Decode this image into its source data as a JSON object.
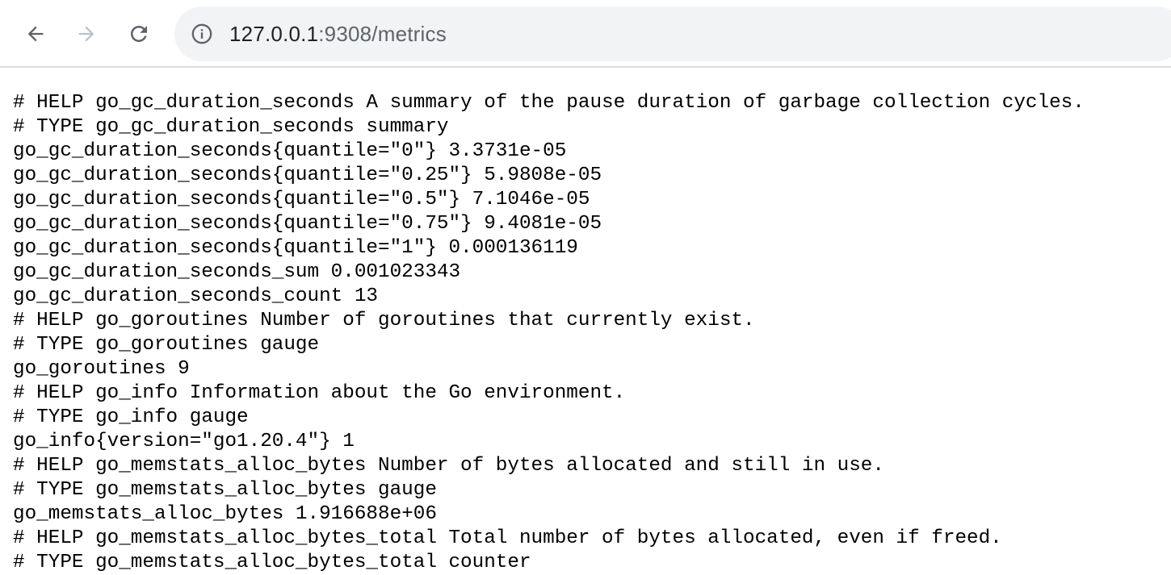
{
  "browser": {
    "back_icon": "arrow-left-icon",
    "forward_icon": "arrow-right-icon",
    "reload_icon": "reload-icon",
    "site_info_icon": "info-circle-icon",
    "url_host": "127.0.0.1",
    "url_rest": ":9308/metrics",
    "colors": {
      "omnibox_bg": "#f1f3f4",
      "icon_active": "#5f6368",
      "icon_disabled": "#bdc1c6"
    }
  },
  "page": {
    "lines": [
      "# HELP go_gc_duration_seconds A summary of the pause duration of garbage collection cycles.",
      "# TYPE go_gc_duration_seconds summary",
      "go_gc_duration_seconds{quantile=\"0\"} 3.3731e-05",
      "go_gc_duration_seconds{quantile=\"0.25\"} 5.9808e-05",
      "go_gc_duration_seconds{quantile=\"0.5\"} 7.1046e-05",
      "go_gc_duration_seconds{quantile=\"0.75\"} 9.4081e-05",
      "go_gc_duration_seconds{quantile=\"1\"} 0.000136119",
      "go_gc_duration_seconds_sum 0.001023343",
      "go_gc_duration_seconds_count 13",
      "# HELP go_goroutines Number of goroutines that currently exist.",
      "# TYPE go_goroutines gauge",
      "go_goroutines 9",
      "# HELP go_info Information about the Go environment.",
      "# TYPE go_info gauge",
      "go_info{version=\"go1.20.4\"} 1",
      "# HELP go_memstats_alloc_bytes Number of bytes allocated and still in use.",
      "# TYPE go_memstats_alloc_bytes gauge",
      "go_memstats_alloc_bytes 1.916688e+06",
      "# HELP go_memstats_alloc_bytes_total Total number of bytes allocated, even if freed.",
      "# TYPE go_memstats_alloc_bytes_total counter"
    ]
  }
}
